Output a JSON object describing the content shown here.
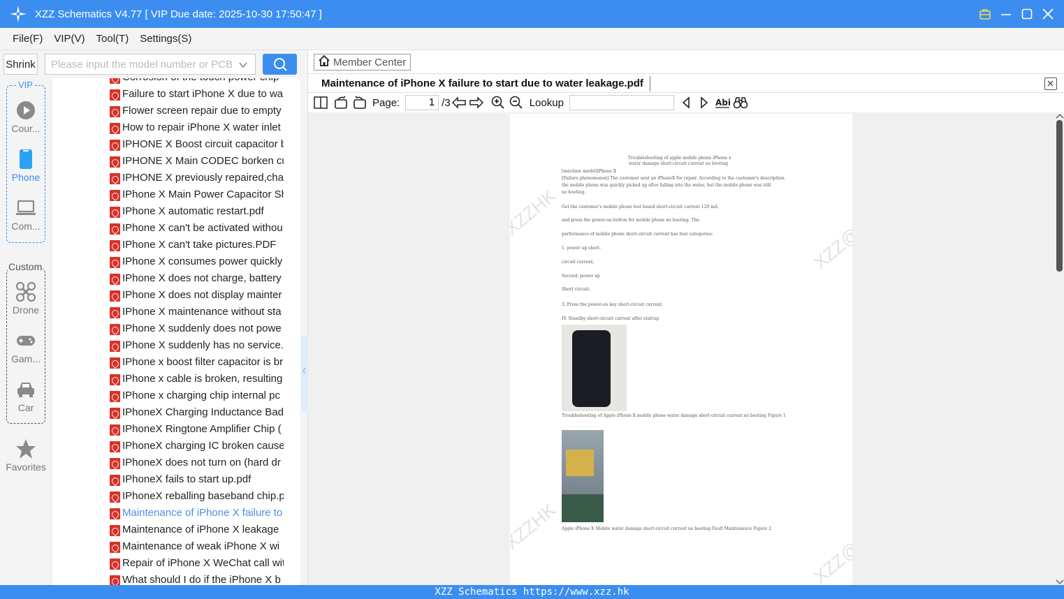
{
  "app": {
    "title": "XZZ Schematics V4.77 [ VIP Due date: 2025-10-30 17:50:47 ]",
    "accent_color": "#3b8ef0"
  },
  "menu": [
    "File(F)",
    "VIP(V)",
    "Tool(T)",
    "Settings(S)"
  ],
  "search": {
    "shrink_label": "Shrink",
    "placeholder": "Please input the model number or PCB"
  },
  "nav": {
    "vip_label": "VIP",
    "custom_label": "Custom",
    "items": [
      {
        "label": "Cour...",
        "icon": "play-circle-icon"
      },
      {
        "label": "Phone",
        "icon": "phone-icon"
      },
      {
        "label": "Com...",
        "icon": "laptop-icon"
      },
      {
        "label": "Drone",
        "icon": "drone-icon"
      },
      {
        "label": "Gam...",
        "icon": "gamepad-icon"
      },
      {
        "label": "Car",
        "icon": "car-icon"
      },
      {
        "label": "Favorites",
        "icon": "star-icon"
      }
    ]
  },
  "files": [
    "Corrosion of the touch power chip",
    "Failure to start iPhone X due to wa",
    "Flower screen repair due to empty",
    "How to repair iPhone X water inlet",
    "IPHONE X Boost circuit capacitor b",
    "IPHONE X Main CODEC borken cu",
    "IPHONE X previously repaired,char",
    "IPhone X Main Power Capacitor Sh",
    "IPhone X automatic restart.pdf",
    "IPhone X can't be activated withou",
    "IPhone X can't take pictures.PDF",
    "IPhone X consumes power quickly",
    "IPhone X does not charge, battery",
    "IPhone X does not display mainter",
    "IPhone X maintenance without sta",
    "IPhone X suddenly does not powe",
    "IPhone X suddenly has no service.p",
    "IPhone x boost filter capacitor is br",
    "IPhone x cable is broken, resulting",
    "IPhone x charging chip internal pc",
    "IPhoneX Charging Inductance Bad",
    "IPhoneX Ringtone Amplifier Chip (",
    "IPhoneX charging IC broken cause",
    "IPhoneX does not turn on (hard dr",
    "IPhoneX fails to start up.pdf",
    "IPhoneX reballing baseband chip.p",
    "Maintenance of iPhone X failure to",
    "Maintenance of iPhone X leakage",
    "Maintenance of weak iPhone X wi",
    "Repair of iPhone X WeChat call wit",
    "What should I do if the iPhone X b"
  ],
  "selected_file_index": 26,
  "viewer": {
    "member_center": "Member Center",
    "doc_title": "Maintenance of iPhone X failure to start due to water leakage.pdf",
    "page_label": "Page:",
    "page_current": "1",
    "page_total": "/3",
    "lookup_label": "Lookup",
    "watermark": "XZZ@XZZHK"
  },
  "pdf_text": [
    "Troubleshooting of apple mobile phone iPhone x",
    "water damage short-circuit current no booting",
    "[machine model]iPhone X",
    "[Failure phenomenon] The customer sent an iPhoneX for repair. According to the customer's description,",
    "the mobile phone was quickly picked up after falling into the water, but the mobile phone was still",
    "no booting.",
    "Get the customer's mobile phone test board short-circuit current 120 mA,",
    "and press the power-on button for mobile phone no booting. The",
    "performance of mobile phone short-circuit current has four categories:",
    "1. power up short-",
    "circuit current;",
    "Second, power up",
    "Short circuit;",
    "3. Press the power-on key short-circuit current;",
    "IV. Standby short-circuit current after startup",
    "Troubleshooting of Apple iPhone X mobile phone water damage short-circuit current no booting     Figure 1",
    "Apple iPhone X Mobile water damage short-circuit current no booting Fault Maintenance Figure 2"
  ],
  "status_bar": "XZZ Schematics https://www.xzz.hk"
}
